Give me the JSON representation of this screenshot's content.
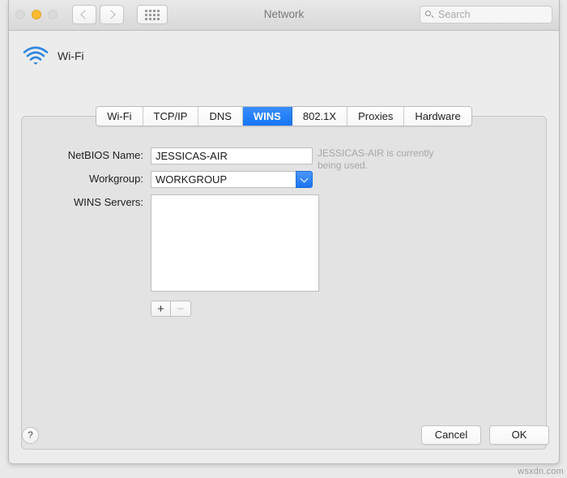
{
  "window": {
    "title": "Network"
  },
  "toolbar": {
    "traffic_lights": [
      {
        "name": "close",
        "state": "inactive"
      },
      {
        "name": "minimize",
        "state": "amber"
      },
      {
        "name": "zoom",
        "state": "inactive"
      }
    ],
    "back_icon": "chevron-left-icon",
    "forward_icon": "chevron-right-icon",
    "showall_icon": "grid-dots-icon",
    "search": {
      "icon": "search-icon",
      "placeholder": "Search",
      "value": ""
    }
  },
  "service": {
    "icon": "wifi-icon",
    "name": "Wi-Fi"
  },
  "tabs": [
    {
      "label": "Wi-Fi",
      "selected": false
    },
    {
      "label": "TCP/IP",
      "selected": false
    },
    {
      "label": "DNS",
      "selected": false
    },
    {
      "label": "WINS",
      "selected": true
    },
    {
      "label": "802.1X",
      "selected": false
    },
    {
      "label": "Proxies",
      "selected": false
    },
    {
      "label": "Hardware",
      "selected": false
    }
  ],
  "form": {
    "netbios": {
      "label": "NetBIOS Name:",
      "value": "JESSICAS-AIR",
      "placeholder": ""
    },
    "workgroup": {
      "label": "Workgroup:",
      "value": "WORKGROUP",
      "dropdown_icon": "chevron-down-icon"
    },
    "wins_servers": {
      "label": "WINS Servers:",
      "entries": []
    },
    "add_button": "+",
    "remove_button": "−",
    "hint": "JESSICAS-AIR is currently being used."
  },
  "footer": {
    "help_label": "?",
    "cancel_label": "Cancel",
    "ok_label": "OK"
  },
  "watermark": "wsxdn.com",
  "colors": {
    "accent_blue": "#1675f5",
    "amber": "#febc2e",
    "window_bg": "#ececec",
    "panel_bg": "#e3e3e3",
    "hint_gray": "#a6a6a6"
  }
}
